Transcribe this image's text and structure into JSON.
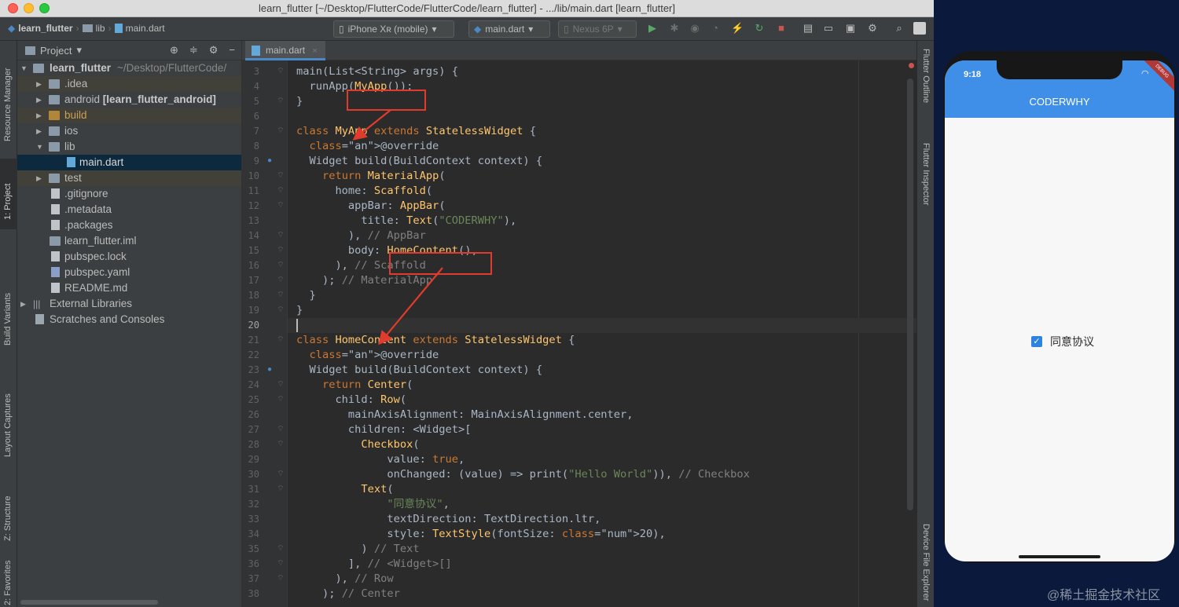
{
  "window": {
    "title": "learn_flutter [~/Desktop/FlutterCode/FlutterCode/learn_flutter] - .../lib/main.dart [learn_flutter]"
  },
  "navbar": {
    "project": "learn_flutter",
    "folder": "lib",
    "file": "main.dart",
    "device_select": "iPhone Xʀ (mobile)",
    "run_config": "main.dart",
    "emulator": "Nexus 6P"
  },
  "left_tabs": [
    "Resource Manager",
    "1: Project",
    "Build Variants",
    "Layout Captures",
    "Z: Structure",
    "2: Favorites"
  ],
  "right_tabs": [
    "Flutter Outline",
    "Flutter Inspector",
    "Device File Explorer"
  ],
  "project_panel": {
    "title": "Project",
    "tree": [
      {
        "label": "learn_flutter",
        "extra": " ~/Desktop/FlutterCode/",
        "bold": true
      },
      {
        "label": ".idea"
      },
      {
        "label": "android",
        "extra": " [learn_flutter_android]"
      },
      {
        "label": "build"
      },
      {
        "label": "ios"
      },
      {
        "label": "lib"
      },
      {
        "label": "main.dart"
      },
      {
        "label": "test"
      },
      {
        "label": ".gitignore"
      },
      {
        "label": ".metadata"
      },
      {
        "label": ".packages"
      },
      {
        "label": "learn_flutter.iml"
      },
      {
        "label": "pubspec.lock"
      },
      {
        "label": "pubspec.yaml"
      },
      {
        "label": "README.md"
      },
      {
        "label": "External Libraries"
      },
      {
        "label": "Scratches and Consoles"
      }
    ]
  },
  "editor": {
    "tab": "main.dart",
    "current_line": 20,
    "line_numbers": [
      3,
      4,
      5,
      6,
      7,
      8,
      9,
      10,
      11,
      12,
      13,
      14,
      15,
      16,
      17,
      18,
      19,
      20,
      21,
      22,
      23,
      24,
      25,
      26,
      27,
      28,
      29,
      30,
      31,
      32,
      33,
      34,
      35,
      36,
      37,
      38
    ],
    "code": [
      "main(List<String> args) {",
      "  runApp(MyApp());",
      "}",
      "",
      "class MyApp extends StatelessWidget {",
      "  @override",
      "  Widget build(BuildContext context) {",
      "    return MaterialApp(",
      "      home: Scaffold(",
      "        appBar: AppBar(",
      "          title: Text(\"CODERWHY\"),",
      "        ), // AppBar",
      "        body: HomeContent(),",
      "      ), // Scaffold",
      "    ); // MaterialApp",
      "  }",
      "}",
      "",
      "class HomeContent extends StatelessWidget {",
      "  @override",
      "  Widget build(BuildContext context) {",
      "    return Center(",
      "      child: Row(",
      "        mainAxisAlignment: MainAxisAlignment.center,",
      "        children: <Widget>[",
      "          Checkbox(",
      "              value: true,",
      "              onChanged: (value) => print(\"Hello World\")), // Checkbox",
      "          Text(",
      "              \"同意协议\",",
      "              textDirection: TextDirection.ltr,",
      "              style: TextStyle(fontSize: 20),",
      "          ) // Text",
      "        ], // <Widget>[]",
      "      ), // Row",
      "    ); // Center"
    ]
  },
  "phone": {
    "time": "9:18",
    "debug_banner": "DEBUG",
    "appbar_title": "CODERWHY",
    "checkbox_checked": true,
    "checkbox_label": "同意协议"
  },
  "watermark": "@稀土掘金技术社区"
}
